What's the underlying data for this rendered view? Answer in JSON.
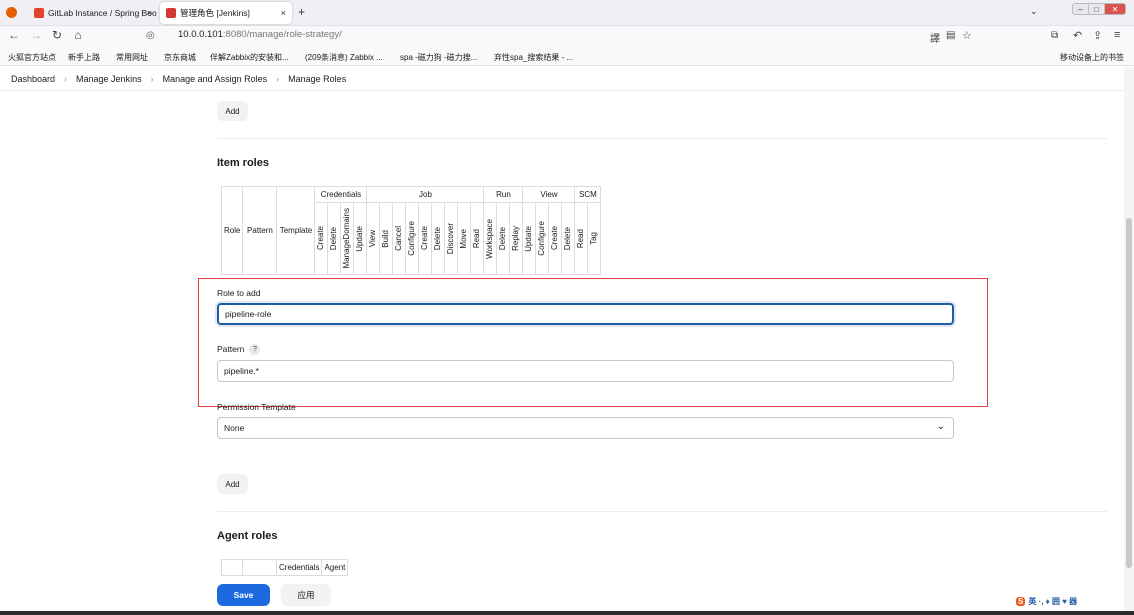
{
  "browser": {
    "tabs": [
      {
        "label": "GitLab Instance / Spring Boo",
        "color": "#e2432a"
      },
      {
        "label": "管理角色 [Jenkins]",
        "color": "#d33833"
      }
    ],
    "new_tab": "+",
    "close_glyph": "×",
    "url_host": "10.0.0.101",
    "url_rest": ":8080/manage/role-strategy/",
    "bookmarks": [
      "火狐官方站点",
      "新手上路",
      "常用网址",
      "京东商城",
      "伴解Zabbix的安装和...",
      "(209条消息) Zabbix ...",
      "spa -磁力狗 -磁力搜...",
      "弃性spa_搜索结果 - ...",
      "移动设备上的书签"
    ]
  },
  "breadcrumb": [
    "Dashboard",
    "Manage Jenkins",
    "Manage and Assign Roles",
    "Manage Roles"
  ],
  "top_add_label": "Add",
  "item_roles": {
    "title": "Item roles",
    "columns": [
      "Role",
      "Pattern",
      "Template"
    ],
    "groups": [
      "Credentials",
      "Job",
      "Run",
      "View",
      "SCM"
    ],
    "permissions": [
      "Create",
      "Delete",
      "ManageDomains",
      "Update",
      "View",
      "Build",
      "Cancel",
      "Configure",
      "Create",
      "Delete",
      "Discover",
      "Move",
      "Read",
      "Workspace",
      "Delete",
      "Replay",
      "Update",
      "Configure",
      "Create",
      "Delete",
      "Read",
      "Tag"
    ],
    "role_to_add_label": "Role to add",
    "role_to_add_value": "pipeline-role",
    "pattern_label": "Pattern",
    "pattern_help": "?",
    "pattern_value": "pipeline.*",
    "permission_template_label": "Permission Template",
    "permission_template_value": "None",
    "add_label": "Add"
  },
  "agent_roles": {
    "title": "Agent roles",
    "groups": [
      "Credentials",
      "Agent"
    ]
  },
  "footer": {
    "save_label": "Save",
    "apply_label": "应用"
  },
  "ime": "英 ·, ♦ 囲 ♥ 器",
  "colors": {
    "primary": "#1d6ae0",
    "highlight_box": "#e04040"
  }
}
